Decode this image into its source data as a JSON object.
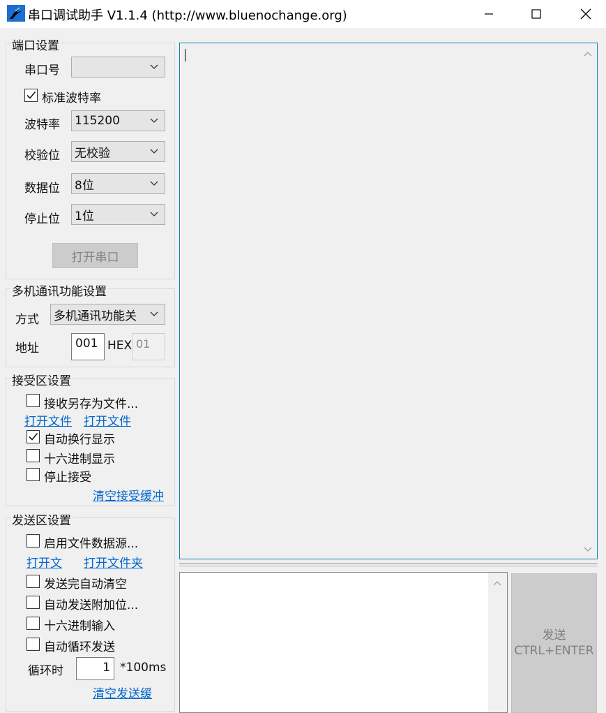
{
  "window": {
    "title": "串口调试助手 V1.1.4 (http://www.bluenochange.org)"
  },
  "port_settings": {
    "group_title": "端口设置",
    "port_label": "串口号",
    "port_value": "",
    "standard_baud_label": "标准波特率",
    "standard_baud_checked": true,
    "baud_label": "波特率",
    "baud_value": "115200",
    "parity_label": "校验位",
    "parity_value": "无校验",
    "databits_label": "数据位",
    "databits_value": "8位",
    "stopbits_label": "停止位",
    "stopbits_value": "1位",
    "open_button": "打开串口"
  },
  "multi_settings": {
    "group_title": "多机通讯功能设置",
    "mode_label": "方式",
    "mode_value": "多机通讯功能关",
    "address_label": "地址",
    "address_value": "001",
    "hex_label": "HEX",
    "hex_value": "01"
  },
  "receive_settings": {
    "group_title": "接受区设置",
    "save_to_file_label": "接收另存为文件...",
    "open_file_link_1": "打开文件",
    "open_file_link_2": "打开文件",
    "auto_wrap_label": "自动换行显示",
    "auto_wrap_checked": true,
    "hex_display_label": "十六进制显示",
    "stop_receive_label": "停止接受",
    "clear_link": "清空接受缓冲"
  },
  "send_settings": {
    "group_title": "发送区设置",
    "file_source_label": "启用文件数据源...",
    "open_file_link": "打开文",
    "open_folder_link": "打开文件夹",
    "auto_clear_label": "发送完自动清空",
    "append_bits_label": "自动发送附加位...",
    "hex_input_label": "十六进制输入",
    "auto_loop_label": "自动循环发送",
    "loop_label": "循环时",
    "loop_value": "1",
    "loop_unit": "*100ms",
    "clear_link": "清空发送缓"
  },
  "send_button": {
    "line1": "发送",
    "line2": "CTRL+ENTER"
  },
  "colors": {
    "accent": "#0d7fb5",
    "link": "#0066cc",
    "window_bg": "#f0f0f0"
  }
}
